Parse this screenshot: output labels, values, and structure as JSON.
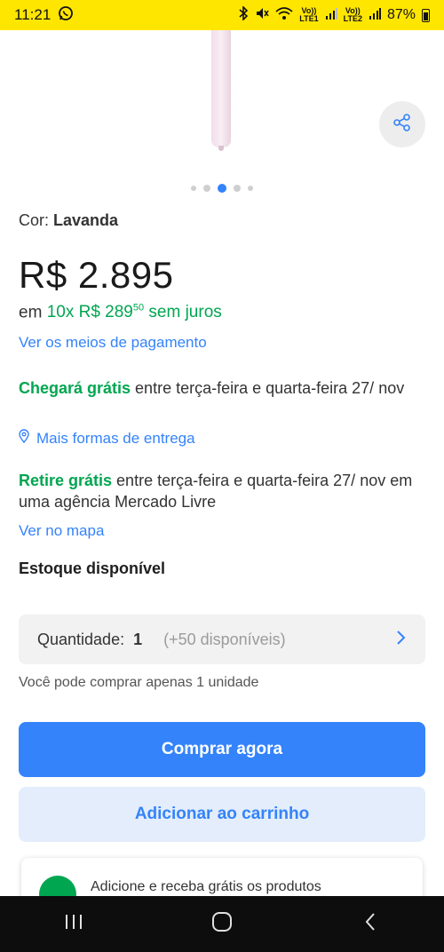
{
  "status_bar": {
    "time": "11:21",
    "lte1": "LTE1",
    "lte2": "LTE2",
    "volte1": "Vo))",
    "volte2": "Vo))",
    "battery": "87%"
  },
  "gallery": {
    "dot_count": 5,
    "active_dot": 2
  },
  "product": {
    "color_label": "Cor: ",
    "color_value": "Lavanda",
    "price": "R$ 2.895",
    "installments_prefix": "em ",
    "installments_count": "10x R$ 289",
    "installments_cents": "50",
    "installments_suffix": " sem juros",
    "payment_link": "Ver os meios de pagamento"
  },
  "shipping": {
    "highlight": "Chegará grátis",
    "text": " entre terça-feira e quarta-feira 27/ nov",
    "more_link": "Mais formas de entrega"
  },
  "pickup": {
    "highlight": "Retire grátis",
    "text": " entre terça-feira e quarta-feira 27/ nov em uma agência Mercado Livre",
    "map_link": "Ver no mapa"
  },
  "stock": {
    "label": "Estoque disponível"
  },
  "quantity": {
    "label": "Quantidade:",
    "value": "1",
    "available": "(+50 disponíveis)",
    "limit_note": "Você pode comprar apenas 1 unidade"
  },
  "actions": {
    "buy_now": "Comprar agora",
    "add_to_cart": "Adicionar ao carrinho"
  },
  "promo": {
    "text": "Adicione e receba grátis os produtos"
  },
  "colors": {
    "brand_yellow": "#ffe600",
    "accent_blue": "#3483fa",
    "green": "#00a650"
  }
}
